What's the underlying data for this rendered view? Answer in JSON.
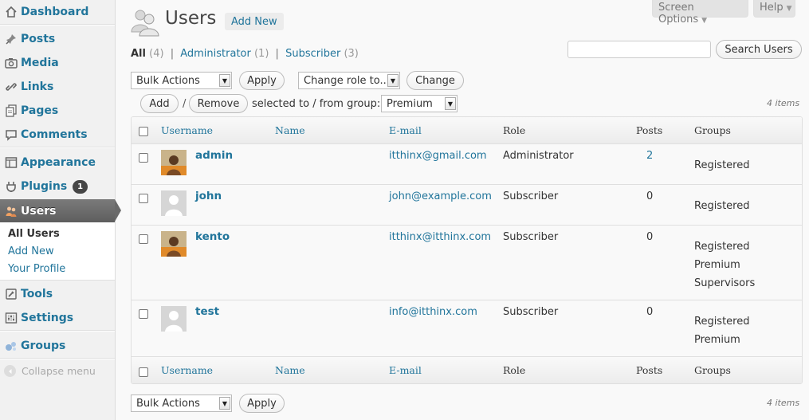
{
  "sidebar": {
    "items": {
      "dashboard": "Dashboard",
      "posts": "Posts",
      "media": "Media",
      "links": "Links",
      "pages": "Pages",
      "comments": "Comments",
      "appearance": "Appearance",
      "plugins": "Plugins",
      "users": "Users",
      "tools": "Tools",
      "settings": "Settings",
      "groups": "Groups"
    },
    "plugins_badge": "1",
    "submenu": {
      "all_users": "All Users",
      "add_new": "Add New",
      "your_profile": "Your Profile"
    },
    "collapse": "Collapse menu"
  },
  "screen_options": "Screen Options",
  "help": "Help",
  "page_title": "Users",
  "add_new_button": "Add New",
  "filters": {
    "all": "All",
    "all_count": "(4)",
    "administrator": "Administrator",
    "administrator_count": "(1)",
    "subscriber": "Subscriber",
    "subscriber_count": "(3)",
    "separator": "|"
  },
  "search": {
    "value": "",
    "button": "Search Users"
  },
  "bulk_actions": {
    "selected": "Bulk Actions",
    "apply": "Apply"
  },
  "change_role": {
    "selected": "Change role to...",
    "button": "Change"
  },
  "group_actions": {
    "add": "Add",
    "slash": "/",
    "remove": "Remove",
    "label": "selected to / from group:",
    "group_selected": "Premium"
  },
  "items_count": "4 items",
  "columns": {
    "username": "Username",
    "name": "Name",
    "email": "E-mail",
    "role": "Role",
    "posts": "Posts",
    "groups": "Groups"
  },
  "users": [
    {
      "username": "admin",
      "name": "",
      "email": "itthinx@gmail.com",
      "role": "Administrator",
      "posts": "2",
      "groups": [
        "Registered"
      ],
      "avatar": "photo"
    },
    {
      "username": "john",
      "name": "",
      "email": "john@example.com",
      "role": "Subscriber",
      "posts": "0",
      "groups": [
        "Registered"
      ],
      "avatar": "default"
    },
    {
      "username": "kento",
      "name": "",
      "email": "itthinx@itthinx.com",
      "role": "Subscriber",
      "posts": "0",
      "groups": [
        "Registered",
        "Premium",
        "Supervisors"
      ],
      "avatar": "photo"
    },
    {
      "username": "test",
      "name": "",
      "email": "info@itthinx.com",
      "role": "Subscriber",
      "posts": "0",
      "groups": [
        "Registered",
        "Premium"
      ],
      "avatar": "default"
    }
  ],
  "colors": {
    "link": "#21759b",
    "active_menu": "#6a6a6a",
    "badge": "#464646"
  },
  "icons": {
    "dashboard": "house-icon",
    "posts": "pushpin-icon",
    "media": "camera-icon",
    "links": "chain-link-icon",
    "pages": "pages-icon",
    "comments": "speech-bubble-icon",
    "appearance": "window-layout-icon",
    "plugins": "plug-icon",
    "users": "people-icon",
    "tools": "hammer-icon",
    "settings": "sliders-icon",
    "groups": "groups-bubbles-icon",
    "collapse": "circle-arrow-left-icon",
    "page_title": "users-large-icon"
  }
}
